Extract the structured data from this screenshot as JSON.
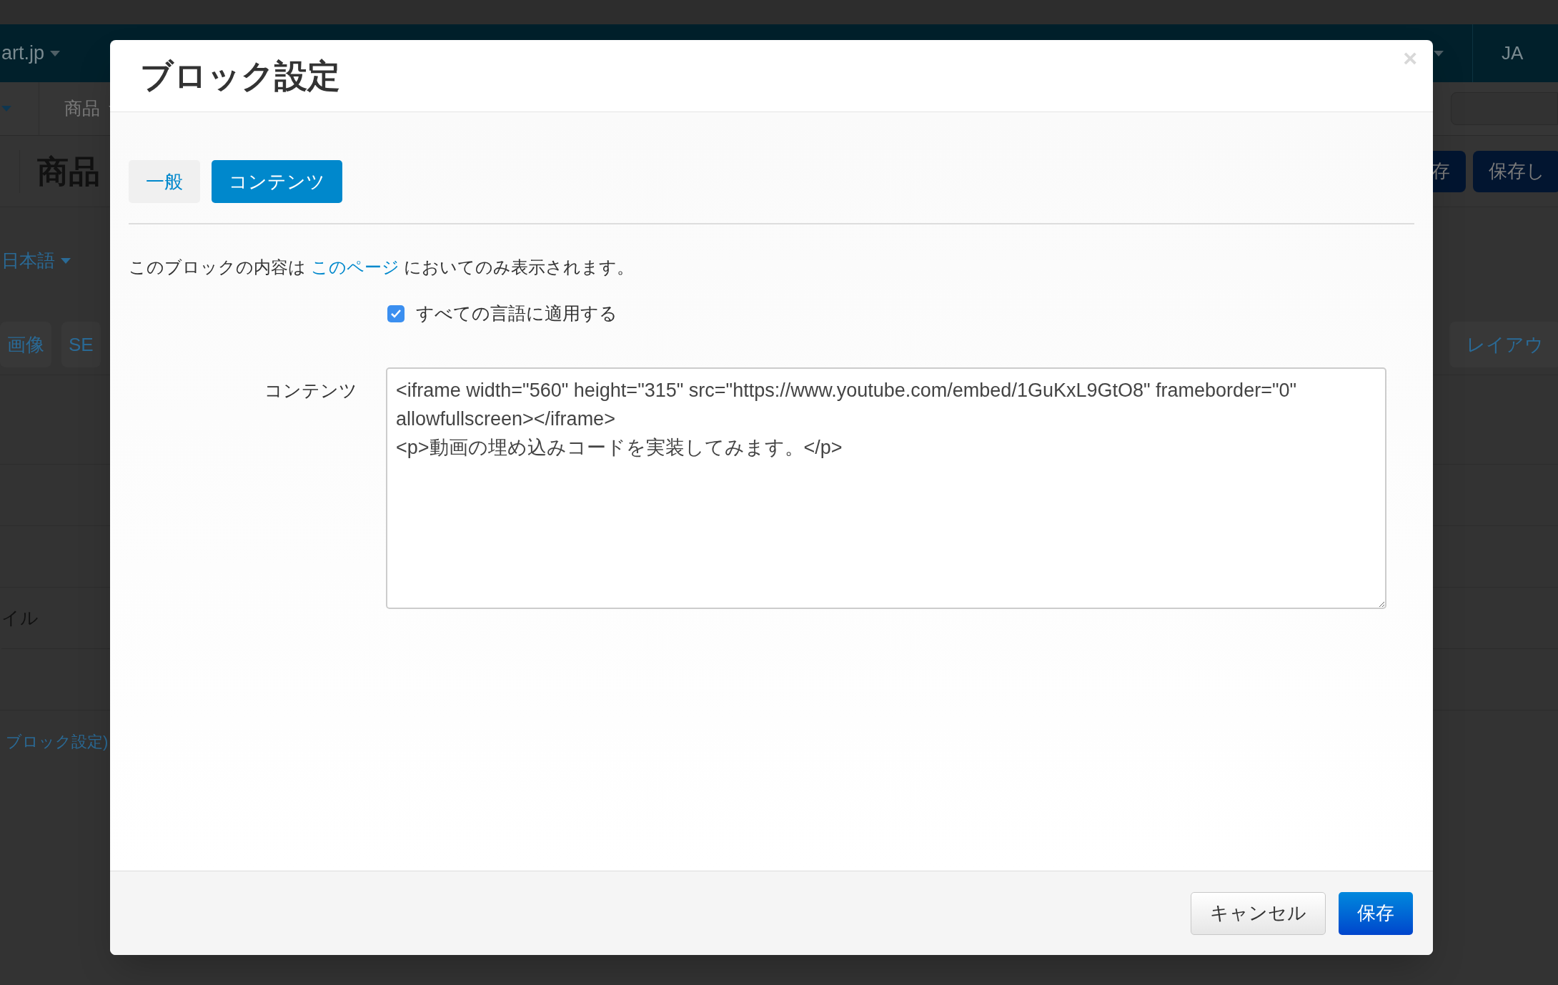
{
  "background": {
    "navbar": {
      "brand": "art.jp",
      "language": "JA"
    },
    "subnav": {
      "menu": "商品"
    },
    "page_title": "商品",
    "header_buttons": [
      "存",
      "保存し"
    ],
    "language_select": "日本語",
    "section_tabs": [
      {
        "label": "画像"
      },
      {
        "label": "SE"
      },
      {
        "label": "レイアウ"
      }
    ],
    "rows": [
      "イル",
      "ブロック設定)"
    ]
  },
  "modal": {
    "title": "ブロック設定",
    "close": "×",
    "tabs": [
      {
        "label": "一般",
        "selected": false
      },
      {
        "label": "コンテンツ",
        "selected": true
      }
    ],
    "notice": {
      "before": "このブロックの内容は",
      "link": "このページ",
      "after": "においてのみ表示されます。"
    },
    "apply_all": {
      "label": "すべての言語に適用する",
      "checked": true
    },
    "content": {
      "label": "コンテンツ",
      "value": "<iframe width=\"560\" height=\"315\" src=\"https://www.youtube.com/embed/1GuKxL9GtO8\" frameborder=\"0\" allowfullscreen></iframe>\n<p>動画の埋め込みコードを実装してみます。</p>"
    },
    "buttons": {
      "cancel": "キャンセル",
      "save": "保存"
    }
  }
}
